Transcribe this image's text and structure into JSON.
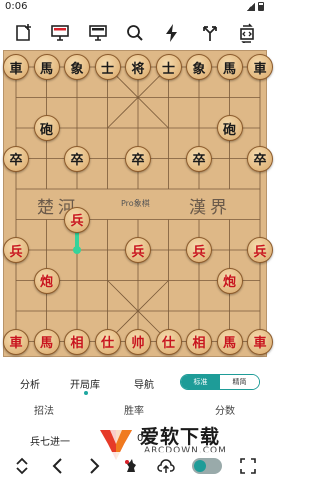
{
  "status": {
    "time": "0:06"
  },
  "toolbar": {
    "icons": [
      "new-file-icon",
      "monitor-red-icon",
      "monitor-icon",
      "search-icon",
      "flash-icon",
      "branch-icon",
      "switch-icon"
    ]
  },
  "board": {
    "river_left": "楚河",
    "river_right": "漢界",
    "watermark": "Pro象棋",
    "pieces": [
      {
        "char": "車",
        "color": "black",
        "col": 0,
        "row": 0
      },
      {
        "char": "馬",
        "color": "black",
        "col": 1,
        "row": 0
      },
      {
        "char": "象",
        "color": "black",
        "col": 2,
        "row": 0
      },
      {
        "char": "士",
        "color": "black",
        "col": 3,
        "row": 0
      },
      {
        "char": "将",
        "color": "black",
        "col": 4,
        "row": 0
      },
      {
        "char": "士",
        "color": "black",
        "col": 5,
        "row": 0
      },
      {
        "char": "象",
        "color": "black",
        "col": 6,
        "row": 0
      },
      {
        "char": "馬",
        "color": "black",
        "col": 7,
        "row": 0
      },
      {
        "char": "車",
        "color": "black",
        "col": 8,
        "row": 0
      },
      {
        "char": "砲",
        "color": "black",
        "col": 1,
        "row": 2
      },
      {
        "char": "砲",
        "color": "black",
        "col": 7,
        "row": 2
      },
      {
        "char": "卒",
        "color": "black",
        "col": 0,
        "row": 3
      },
      {
        "char": "卒",
        "color": "black",
        "col": 2,
        "row": 3
      },
      {
        "char": "卒",
        "color": "black",
        "col": 4,
        "row": 3
      },
      {
        "char": "卒",
        "color": "black",
        "col": 6,
        "row": 3
      },
      {
        "char": "卒",
        "color": "black",
        "col": 8,
        "row": 3
      },
      {
        "char": "兵",
        "color": "red",
        "col": 0,
        "row": 6
      },
      {
        "char": "兵",
        "color": "red",
        "col": 2,
        "row": 5
      },
      {
        "char": "兵",
        "color": "red",
        "col": 4,
        "row": 6
      },
      {
        "char": "兵",
        "color": "red",
        "col": 6,
        "row": 6
      },
      {
        "char": "兵",
        "color": "red",
        "col": 8,
        "row": 6
      },
      {
        "char": "炮",
        "color": "red",
        "col": 1,
        "row": 7
      },
      {
        "char": "炮",
        "color": "red",
        "col": 7,
        "row": 7
      },
      {
        "char": "車",
        "color": "red",
        "col": 0,
        "row": 9
      },
      {
        "char": "馬",
        "color": "red",
        "col": 1,
        "row": 9
      },
      {
        "char": "相",
        "color": "red",
        "col": 2,
        "row": 9
      },
      {
        "char": "仕",
        "color": "red",
        "col": 3,
        "row": 9
      },
      {
        "char": "帅",
        "color": "red",
        "col": 4,
        "row": 9
      },
      {
        "char": "仕",
        "color": "red",
        "col": 5,
        "row": 9
      },
      {
        "char": "相",
        "color": "red",
        "col": 6,
        "row": 9
      },
      {
        "char": "馬",
        "color": "red",
        "col": 7,
        "row": 9
      },
      {
        "char": "車",
        "color": "red",
        "col": 8,
        "row": 9
      }
    ],
    "last_move": {
      "from": {
        "col": 2,
        "row": 6
      },
      "to": {
        "col": 2,
        "row": 5
      }
    }
  },
  "tabs": {
    "analysis": "分析",
    "opening_book": "开局库",
    "navigation": "导航",
    "mode_standard": "标准",
    "mode_precise": "精简"
  },
  "columns": {
    "move": "招法",
    "win_rate": "胜率",
    "score": "分数"
  },
  "moves": [
    {
      "text": "兵七进一",
      "num": "0"
    }
  ],
  "brand": {
    "title": "爱软下载",
    "subtitle": "ARCDOWN.COM"
  },
  "colors": {
    "accent": "#1e9c98",
    "board": "#deb887",
    "red_piece": "#c8141e"
  }
}
